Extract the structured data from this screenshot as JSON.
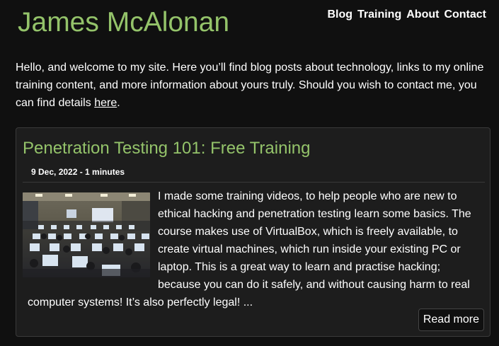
{
  "site": {
    "title": "James McAlonan",
    "nav": [
      {
        "label": "Blog"
      },
      {
        "label": "Training"
      },
      {
        "label": "About"
      },
      {
        "label": "Contact"
      }
    ]
  },
  "intro": {
    "text": "Hello, and welcome to my site. Here you’ll find blog posts about technology, links to my online training content, and more information about yours truly. Should you wish to contact me, you can find details ",
    "link_label": "here",
    "end": "."
  },
  "post": {
    "title": "Penetration Testing 101: Free Training",
    "meta": "9 Dec, 2022 - 1 minutes",
    "excerpt": "I made some training videos, to help people who are new to ethical hacking and penetration testing learn some basics. The course makes use of VirtualBox, which is freely available, to create virtual machines, which run inside your existing PC or laptop. This is a great way to learn and practise hacking; because you can do it safely, and without causing harm to real computer systems! It’s also perfectly legal! ...",
    "read_more_label": "Read more"
  },
  "colors": {
    "background": "#101010",
    "card_background": "#1d1d1d",
    "accent_green": "#94c36a",
    "text": "#ffffff"
  }
}
